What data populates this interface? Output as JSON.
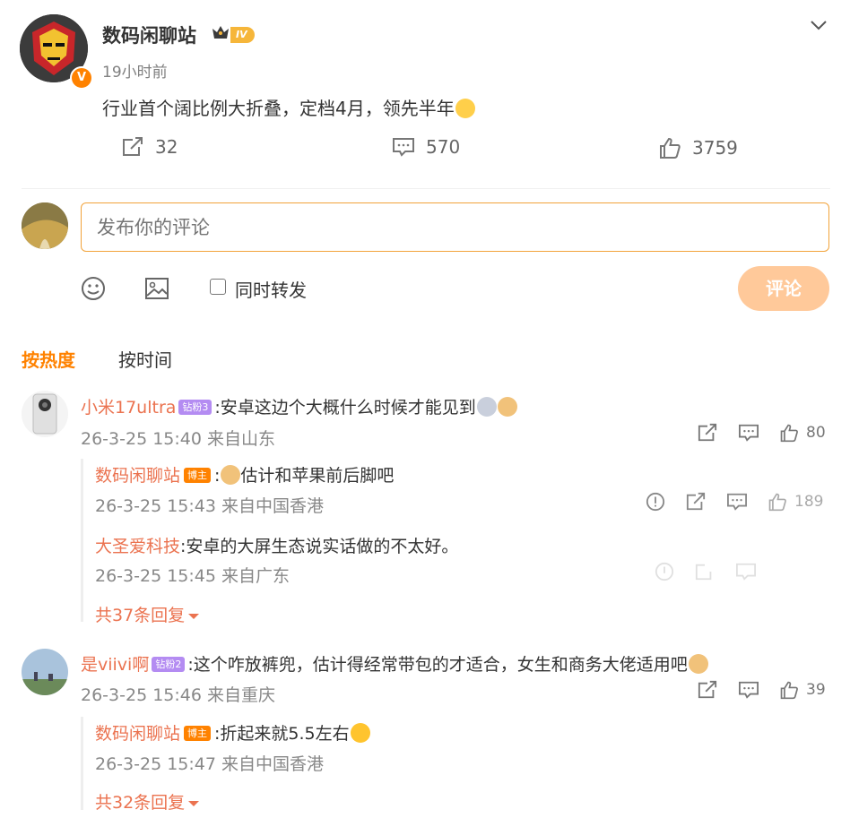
{
  "post": {
    "author": "数码闲聊站",
    "level_badge": "IV",
    "time": "19小时前",
    "content": "行业首个阔比例大折叠，定档4月，领先半年",
    "verified_mark": "V",
    "actions": {
      "reposts": "32",
      "comments": "570",
      "likes": "3759"
    }
  },
  "composer": {
    "placeholder": "发布你的评论",
    "also_repost_label": "同时转发",
    "submit_label": "评论"
  },
  "sort": {
    "hot": "按热度",
    "time": "按时间"
  },
  "comments": [
    {
      "user": "小米17ultra",
      "fan_badge": "钻粉3",
      "text": ":安卓这边个大概什么时候才能见到",
      "meta": "26-3-25 15:40 来自山东",
      "likes": "80",
      "replies": [
        {
          "user": "数码闲聊站",
          "host_badge": "博主",
          "text": ":",
          "text2": "估计和苹果前后脚吧",
          "meta": "26-3-25 15:43 来自中国香港",
          "likes": "189"
        },
        {
          "user": "大圣爱科技",
          "text": ":安卓的大屏生态说实话做的不太好。",
          "meta": "26-3-25 15:45 来自广东"
        }
      ],
      "more_replies": "共37条回复"
    },
    {
      "user": "是viivi啊",
      "fan_badge": "钻粉2",
      "text": ":这个咋放裤兜，估计得经常带包的才适合，女生和商务大佬适用吧",
      "meta": "26-3-25 15:46 来自重庆",
      "likes": "39",
      "replies": [
        {
          "user": "数码闲聊站",
          "host_badge": "博主",
          "text": ":折起来就5.5左右",
          "meta": "26-3-25 15:47 来自中国香港"
        }
      ],
      "more_replies": "共32条回复"
    }
  ],
  "colors": {
    "accent": "#ff8200",
    "username": "#eb7350",
    "submit_bg": "#ffc99a"
  }
}
